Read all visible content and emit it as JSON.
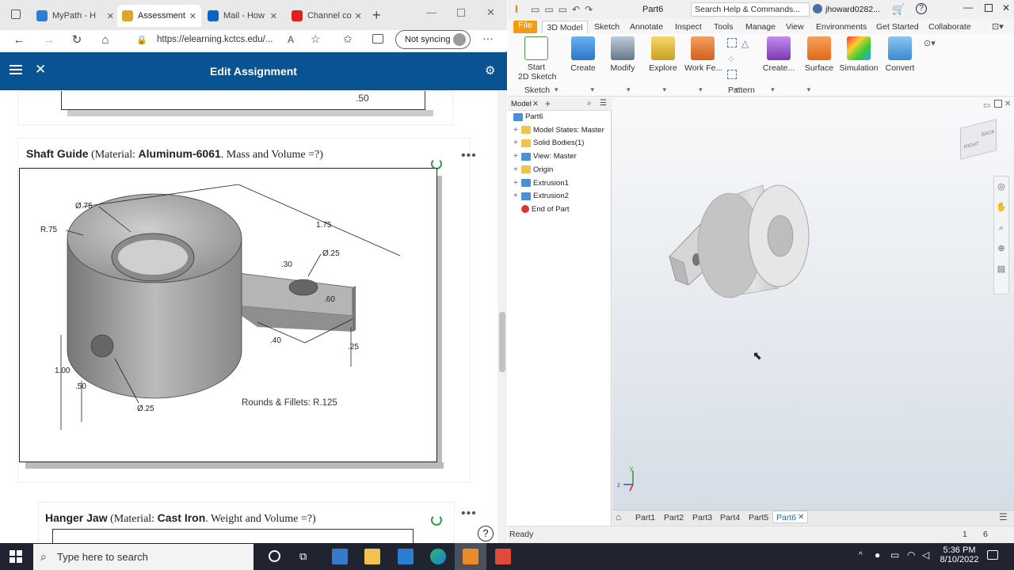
{
  "browser": {
    "tabs": [
      {
        "title": "MyPath - H",
        "active": false
      },
      {
        "title": "Assessment",
        "active": true
      },
      {
        "title": "Mail - How",
        "active": false
      },
      {
        "title": "Channel co",
        "active": false
      }
    ],
    "url": "https://elearning.kctcs.edu/...",
    "sync_label": "Not syncing",
    "page_title": "Edit Assignment"
  },
  "assignment": {
    "q1": {
      "name": "Shaft Guide",
      "material_prefix": "(Material: ",
      "material": "Aluminum-6061",
      "suffix": ". Mass and Volume =?)",
      "drawing_note": "Rounds & Fillets: R.125",
      "dims": {
        "d_hole_top": "Ø.75",
        "r_outer": "R.75",
        "length": "1.75",
        "d_hole_small": ".25",
        "width_arm": ".40",
        "thk_arm": ".25",
        "height": "1.00",
        "half_height": ".50",
        "d_side_hole": ".25",
        "top_offset": ".50",
        "small_60": ".60",
        "small_30": ".30"
      }
    },
    "q2": {
      "name": "Hanger Jaw",
      "material_prefix": "(Material: ",
      "material": "Cast Iron",
      "suffix": ". Weight and Volume =?)"
    }
  },
  "inventor": {
    "doc_title": "Part6",
    "search_placeholder": "Search Help & Commands...",
    "user": "jhoward0282...",
    "ribbon_tabs": [
      "File",
      "3D Model",
      "Sketch",
      "Annotate",
      "Inspect",
      "Tools",
      "Manage",
      "View",
      "Environments",
      "Get Started",
      "Collaborate"
    ],
    "active_ribbon_tab": "3D Model",
    "ribbon_buttons": {
      "start_sketch_1": "Start",
      "start_sketch_2": "2D Sketch",
      "create": "Create",
      "modify": "Modify",
      "explore": "Explore",
      "work_features": "Work Fe...",
      "create_freeform": "Create...",
      "surface": "Surface",
      "simulation": "Simulation",
      "convert": "Convert"
    },
    "ribbon_groups": {
      "sketch": "Sketch",
      "pattern": "Pattern"
    },
    "browser_tab": "Model",
    "tree": [
      {
        "label": "Part6",
        "icon": "part-icon",
        "indent": 0,
        "expander": false
      },
      {
        "label": "Model States: Master",
        "icon": "folder-icon",
        "indent": 1,
        "expander": true
      },
      {
        "label": "Solid Bodies(1)",
        "icon": "folder-icon",
        "indent": 1,
        "expander": true
      },
      {
        "label": "View: Master",
        "icon": "view-icon",
        "indent": 1,
        "expander": true
      },
      {
        "label": "Origin",
        "icon": "folder-icon",
        "indent": 1,
        "expander": true
      },
      {
        "label": "Extrusion1",
        "icon": "extrusion-icon",
        "indent": 1,
        "expander": true
      },
      {
        "label": "Extrusion2",
        "icon": "extrusion-icon",
        "indent": 1,
        "expander": true
      },
      {
        "label": "End of Part",
        "icon": "end-of-part-icon",
        "indent": 1,
        "expander": false
      }
    ],
    "document_tabs": [
      "Part1",
      "Part2",
      "Part3",
      "Part4",
      "Part5",
      "Part6"
    ],
    "active_document": "Part6",
    "status": "Ready",
    "status_nums": [
      "1",
      "6"
    ],
    "viewcube_faces": {
      "front": "RIGHT",
      "side": "BACK"
    }
  },
  "taskbar": {
    "search_placeholder": "Type here to search",
    "time": "5:36 PM",
    "date": "8/10/2022"
  },
  "colors": {
    "page_header": "#0a5393",
    "file_tab": "#f39c12",
    "model_gray": "#d9d9d9"
  }
}
